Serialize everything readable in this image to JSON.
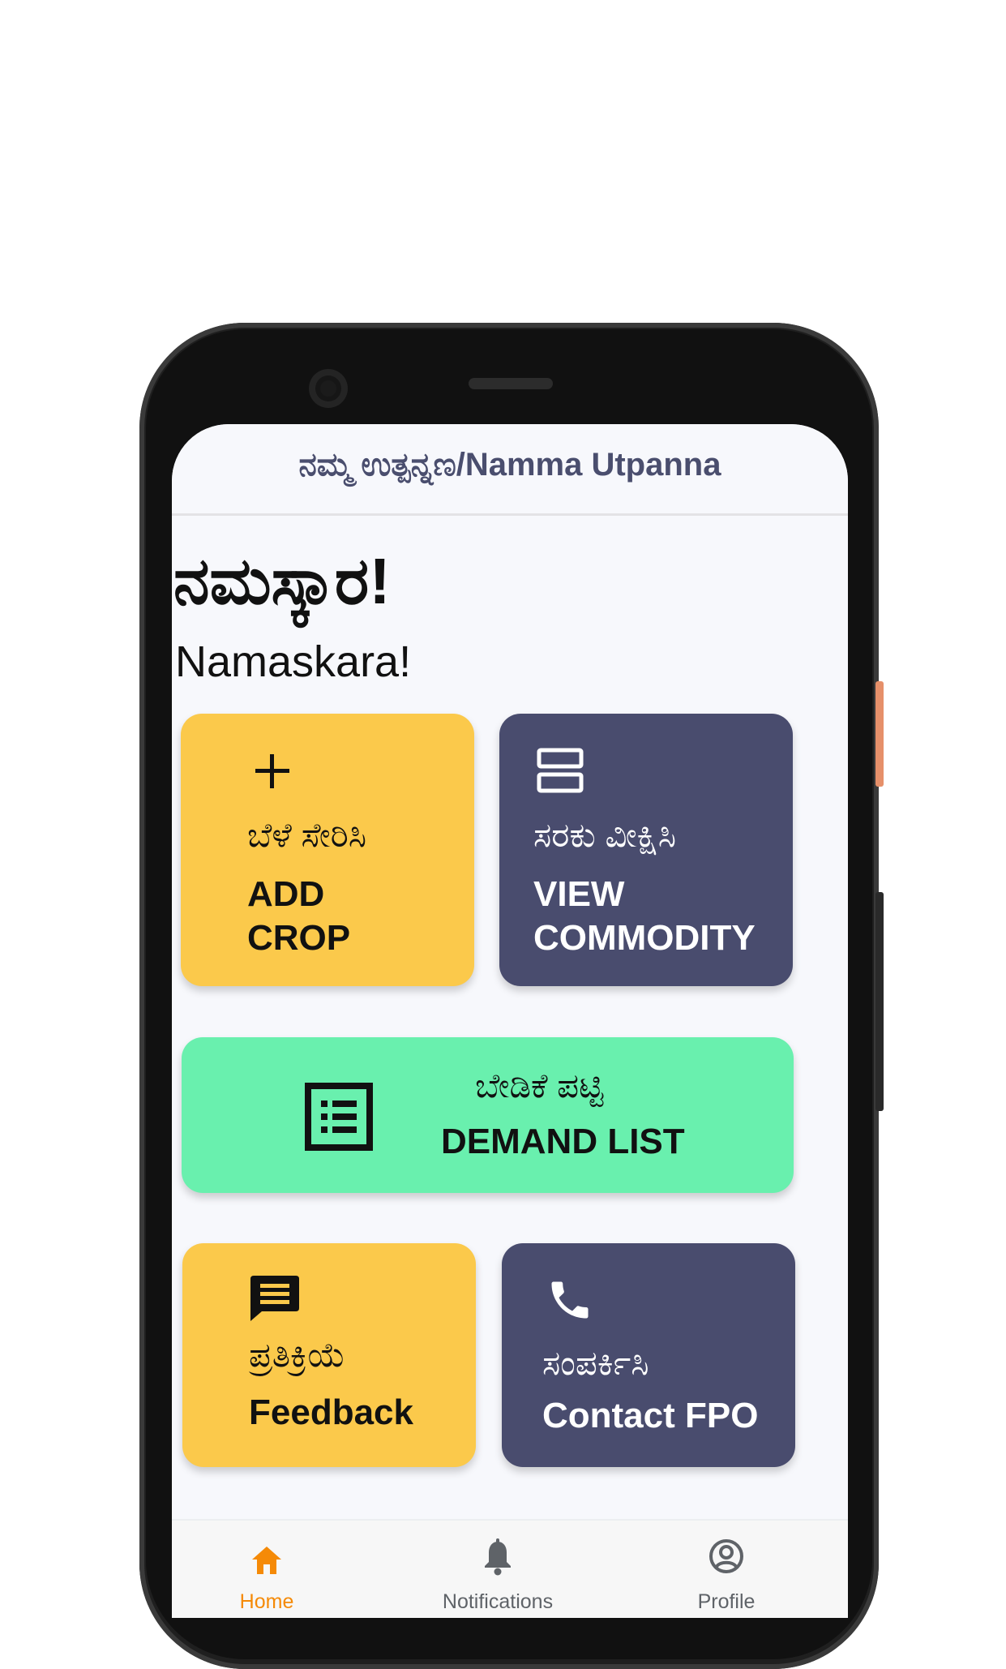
{
  "app": {
    "title": "ನಮ್ಮ ಉತ್ಪನ್ನಣ/Namma Utpanna"
  },
  "greeting": {
    "kannada": "ನಮಸ್ಕಾರ!",
    "english": "Namaskara!"
  },
  "cards": {
    "add_crop": {
      "kn": "ಬೆಳೆ ಸೇರಿಸಿ",
      "en_line1": "ADD",
      "en_line2": "CROP",
      "icon": "plus-icon"
    },
    "view_commodity": {
      "kn": "ಸರಕು ವೀಕ್ಷಿಸಿ",
      "en_line1": "VIEW",
      "en_line2": "COMMODITY",
      "icon": "view-agenda-icon"
    },
    "demand_list": {
      "kn": "ಬೇಡಿಕೆ ಪಟ್ಟಿ",
      "en": "DEMAND LIST",
      "icon": "list-icon"
    },
    "feedback": {
      "kn": "ಪ್ರತಿಕ್ರಿಯೆ",
      "en": "Feedback",
      "icon": "chat-icon"
    },
    "contact_fpo": {
      "kn": "ಸಂಪರ್ಕಿಸಿ",
      "en": "Contact FPO",
      "icon": "phone-icon"
    }
  },
  "bottom_nav": {
    "items": [
      {
        "label": "Home",
        "icon": "home-icon",
        "active": true
      },
      {
        "label": "Notifications",
        "icon": "bell-icon",
        "active": false
      },
      {
        "label": "Profile",
        "icon": "profile-icon",
        "active": false
      }
    ]
  },
  "colors": {
    "yellow": "#fbc94b",
    "navy": "#494c6e",
    "green": "#69f0ae",
    "active_nav": "#f58a07",
    "inactive_nav": "#5f6368"
  }
}
